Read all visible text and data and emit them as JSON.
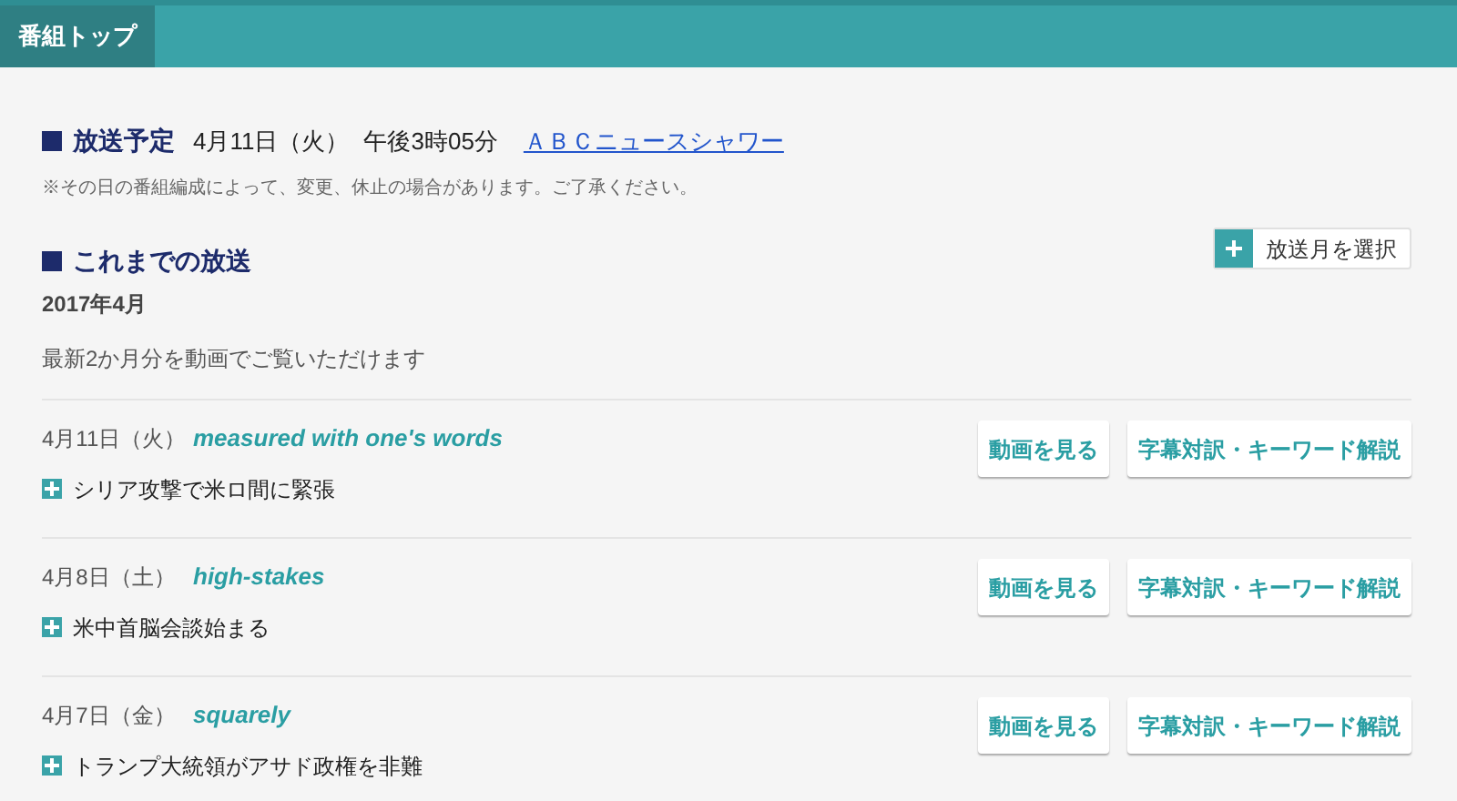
{
  "tab": {
    "label": "番組トップ",
    "selected": true
  },
  "schedule": {
    "heading": "放送予定",
    "date": "4月11日（火）",
    "time": "午後3時05分",
    "program_link": "ＡＢＣニュースシャワー",
    "note": "※その日の番組編成によって、変更、休止の場合があります。ご了承ください。"
  },
  "archive": {
    "heading": "これまでの放送",
    "month": "2017年4月",
    "select_button": "放送月を選択",
    "description": "最新2か月分を動画でご覧いただけます"
  },
  "episodes": [
    {
      "date": "4月11日（火）",
      "phrase": "measured with one's words",
      "headline": "シリア攻撃で米ロ間に緊張",
      "video_button": "動画を見る",
      "subtitle_button": "字幕対訳・キーワード解説"
    },
    {
      "date": "4月8日（土）",
      "phrase": "high-stakes",
      "headline": "米中首脳会談始まる",
      "video_button": "動画を見る",
      "subtitle_button": "字幕対訳・キーワード解説"
    },
    {
      "date": "4月7日（金）",
      "phrase": "squarely",
      "headline": "トランプ大統領がアサド政権を非難",
      "video_button": "動画を見る",
      "subtitle_button": "字幕対訳・キーワード解説"
    }
  ]
}
